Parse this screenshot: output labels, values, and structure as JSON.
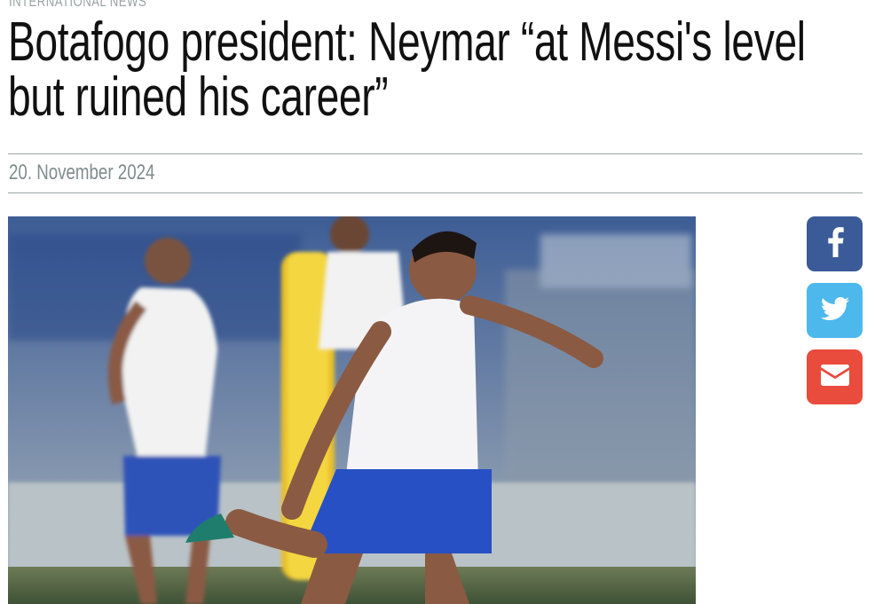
{
  "article": {
    "category": "International News",
    "headline": "Botafogo president: Neymar “at Messi's level but ruined his career”",
    "date": "20. November 2024"
  },
  "share": {
    "facebook_icon": "facebook-icon",
    "twitter_icon": "twitter-icon",
    "email_icon": "envelope-icon"
  },
  "colors": {
    "facebook": "#3b5a98",
    "twitter": "#4db8ec",
    "email": "#e94b3c",
    "rule": "#9aa7a8",
    "muted_text": "#7f8c8d"
  }
}
